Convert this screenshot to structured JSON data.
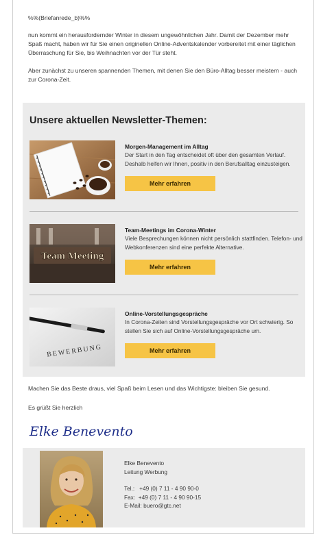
{
  "salutation": "%%(Briefanrede_b)%%",
  "intro": [
    "nun kommt ein herausfordernder Winter in diesem ungewöhnlichen Jahr. Damit der Dezember mehr Spaß macht, haben wir für Sie einen originellen Online-Adventskalender vorbereitet mit einer täglichen Überraschung für Sie, bis Weihnachten vor der Tür steht.",
    "Aber zunächst zu unseren spannenden Themen, mit denen Sie den Büro-Alltag besser meistern - auch zur Corona-Zeit."
  ],
  "topics_heading": "Unsere aktuellen Newsletter-Themen:",
  "topics": [
    {
      "title": "Morgen-Management im Alltag",
      "description": "Der Start in den Tag entscheidet oft über den gesamten Verlauf. Deshalb helfen wir Ihnen, positiv in den Berufsalltag einzusteigen.",
      "button": "Mehr erfahren",
      "image_icon": "notebook-coffee-photo"
    },
    {
      "title": "Team-Meetings im Corona-Winter",
      "description": "Viele Besprechungen können nicht persönlich stattfinden. Telefon- und Webkonferenzen sind eine perfekte Alternative.",
      "button": "Mehr erfahren",
      "image_icon": "team-meeting-photo",
      "image_caption": "Team Meeting"
    },
    {
      "title": "Online-Vorstellungsgespräche",
      "description": "In Corona-Zeiten sind Vorstellungsgespräche vor Ort schwierig. So stellen Sie sich auf Online-Vorstellungsgespräche um.",
      "button": "Mehr erfahren",
      "image_icon": "application-pen-photo",
      "image_caption": "BEWERBUNG"
    }
  ],
  "closing": "Machen Sie das Beste draus, viel Spaß beim Lesen und das Wichtigste: bleiben Sie gesund.",
  "greeting": "Es grüßt Sie herzlich",
  "signature": "Elke Benevento",
  "colors": {
    "accent_button": "#f6c445",
    "panel_background": "#ebebeb",
    "signature_ink": "#1f2f8a"
  },
  "contact": {
    "name": "Elke Benevento",
    "role": "Leitung Werbung",
    "tel": "Tel.:   +49 (0) 7 11 - 4 90 90-0",
    "fax": "Fax:  +49 (0) 7 11 - 4 90 90-15",
    "email": "E-Mail: buero@gtc.net"
  }
}
